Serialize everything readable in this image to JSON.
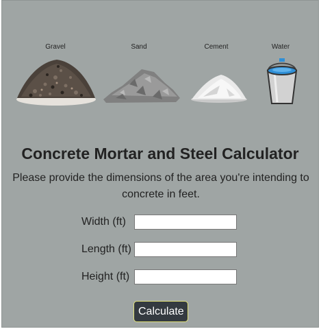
{
  "materials": [
    {
      "label": "Gravel",
      "icon": "gravel-pile-icon"
    },
    {
      "label": "Sand",
      "icon": "sand-pile-icon"
    },
    {
      "label": "Cement",
      "icon": "cement-pile-icon"
    },
    {
      "label": "Water",
      "icon": "water-bucket-icon"
    }
  ],
  "header": {
    "title": "Concrete Mortar and Steel Calculator",
    "description": "Please provide the dimensions of the area you're intending to concrete in feet."
  },
  "form": {
    "width_label": "Width (ft)",
    "width_value": "",
    "length_label": "Length (ft)",
    "length_value": "",
    "height_label": "Height (ft)",
    "height_value": "",
    "submit_label": "Calculate"
  },
  "colors": {
    "background": "#9fa5a4",
    "button_bg": "#343a40",
    "button_border": "#e3e37a",
    "water": "#2f8fd6"
  }
}
